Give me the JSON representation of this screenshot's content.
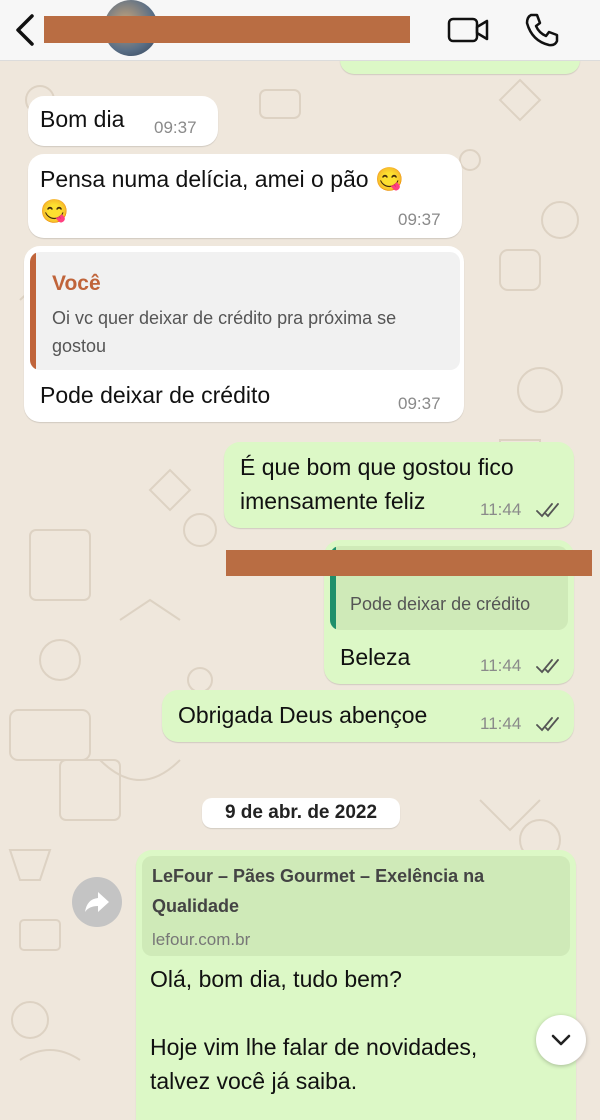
{
  "colors": {
    "incoming": "#ffffff",
    "outgoing": "#dcf8c6",
    "quote_you": "#c0643a",
    "quote_other": "#1f8f6b",
    "redaction": "#b96d43"
  },
  "header": {
    "back_icon": "chevron-left-icon",
    "video_icon": "video-camera-icon",
    "call_icon": "phone-icon"
  },
  "messages": [
    {
      "text": "Bom dia",
      "time": "09:37"
    },
    {
      "line1": "Pensa numa delícia, amei o pão 😋",
      "line2": "😋",
      "time": "09:37"
    },
    {
      "quote_author": "Você",
      "quote_line1": "Oi vc quer deixar de crédito pra próxima se",
      "quote_line2": "gostou",
      "text": "Pode deixar de crédito",
      "time": "09:37"
    },
    {
      "line1": "É que bom que gostou fico",
      "line2": "imensamente feliz",
      "time": "11:44"
    },
    {
      "quote_line": "Pode deixar de crédito",
      "text": "Beleza",
      "time": "11:44"
    },
    {
      "text": "Obrigada Deus abençoe",
      "time": "11:44"
    }
  ],
  "date_divider": "9 de abr. de 2022",
  "link_message": {
    "preview_title_1": "LeFour – Pães Gourmet – Exelência na",
    "preview_title_2": "Qualidade",
    "preview_domain": "lefour.com.br",
    "body_1": "Olá, bom dia, tudo bem?",
    "body_2": "Hoje vim lhe falar de novidades,",
    "body_3": "talvez você já saiba."
  }
}
